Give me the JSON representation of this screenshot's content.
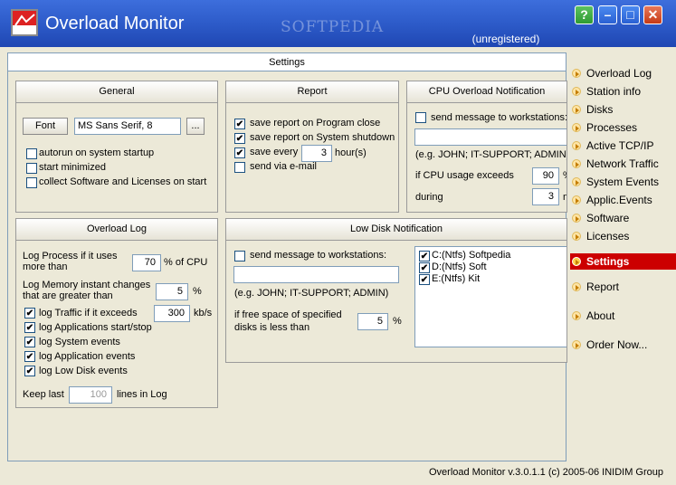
{
  "window": {
    "title": "Overload Monitor",
    "watermark": "SOFTPEDIA",
    "status": "(unregistered)",
    "help_label": "?",
    "min_label": "–",
    "max_label": "□",
    "close_label": "✕"
  },
  "main": {
    "header": "Settings"
  },
  "general": {
    "title": "General",
    "font_button": "Font",
    "font_value": "MS Sans Serif, 8",
    "browse_label": "...",
    "options": [
      {
        "label": "autorun on system startup",
        "checked": false
      },
      {
        "label": "start minimized",
        "checked": false
      },
      {
        "label": "collect Software and Licenses on start",
        "checked": false
      }
    ]
  },
  "report": {
    "title": "Report",
    "opt_close": "save report on Program close",
    "opt_shutdown": "save report on System shutdown",
    "save_every_label": "save every",
    "save_every_value": "3",
    "hours_label": "hour(s)",
    "send_email": "send via e-mail"
  },
  "cpu": {
    "title": "CPU Overload Notification",
    "send_label": "send message to workstations:",
    "workstations_value": "",
    "example": "(e.g. JOHN; IT-SUPPORT; ADMIN)",
    "exceeds_label": "if CPU usage exceeds",
    "exceeds_value": "90",
    "exceeds_unit": "%",
    "during_label": "during",
    "during_value": "3",
    "during_unit": "m"
  },
  "overload": {
    "title": "Overload Log",
    "process_label": "Log Process if it uses more than",
    "process_value": "70",
    "process_unit": "% of CPU",
    "memory_label": "Log Memory instant changes that are greater than",
    "memory_value": "5",
    "memory_unit": "%",
    "traffic_label": "log Traffic if it exceeds",
    "traffic_value": "300",
    "traffic_unit": "kb/s",
    "apps_label": "log Applications start/stop",
    "sys_events_label": "log System events",
    "app_events_label": "log Application events",
    "disk_events_label": "log Low Disk events",
    "keep_label": "Keep last",
    "keep_value": "100",
    "keep_unit": "lines in Log"
  },
  "lowdisk": {
    "title": "Low Disk Notification",
    "send_label": "send message to workstations:",
    "workstations_value": "",
    "example": "(e.g. JOHN; IT-SUPPORT; ADMIN)",
    "free_label": "if free space of specified disks is less than",
    "free_value": "5",
    "free_unit": "%",
    "disks": [
      {
        "label": "C:(Ntfs) Softpedia",
        "checked": true
      },
      {
        "label": "D:(Ntfs) Soft",
        "checked": true
      },
      {
        "label": "E:(Ntfs) Kit",
        "checked": true
      }
    ]
  },
  "sidebar": {
    "items": [
      {
        "label": "Overload Log",
        "icon": "arrow-icon"
      },
      {
        "label": "Station info",
        "icon": "arrow-icon"
      },
      {
        "label": "Disks",
        "icon": "arrow-icon"
      },
      {
        "label": "Processes",
        "icon": "arrow-icon"
      },
      {
        "label": "Active TCP/IP",
        "icon": "arrow-icon"
      },
      {
        "label": "Network Traffic",
        "icon": "arrow-icon"
      },
      {
        "label": "System Events",
        "icon": "arrow-icon"
      },
      {
        "label": "Applic.Events",
        "icon": "arrow-icon"
      },
      {
        "label": "Software",
        "icon": "arrow-icon"
      },
      {
        "label": "Licenses",
        "icon": "arrow-icon"
      },
      {
        "label": "Settings",
        "icon": "arrow-icon",
        "active": true
      },
      {
        "label": "Report",
        "icon": "arrow-icon"
      },
      {
        "label": "About",
        "icon": "arrow-icon"
      },
      {
        "label": "Order Now...",
        "icon": "arrow-icon"
      }
    ]
  },
  "footer": "Overload Monitor v.3.0.1.1 (c) 2005-06 INIDIM Group",
  "colors": {
    "title_bar": "#2D5BC9",
    "active_nav": "#CC0000",
    "background": "#ECE9D8"
  }
}
